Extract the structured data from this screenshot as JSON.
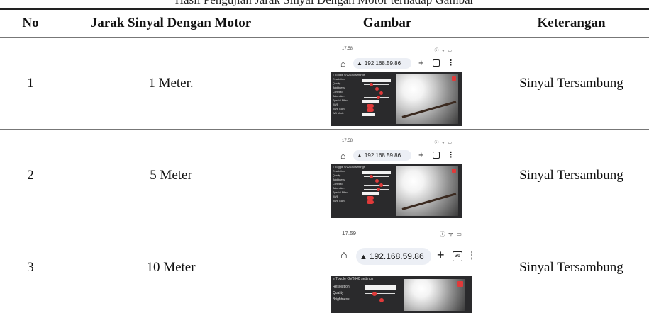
{
  "caption": "Hasil Pengujian Jarak Sinyal Dengan Motor terhadap Gambar",
  "table": {
    "headers": {
      "no": "No",
      "jarak": "Jarak Sinyal Dengan Motor",
      "gambar": "Gambar",
      "keterangan": "Keterangan"
    },
    "rows": [
      {
        "no": "1",
        "jarak": "1 Meter.",
        "keterangan": "Sinyal Tersambung",
        "shot": {
          "time": "17.58",
          "status_icons": "ⓘ ᯤ ▭",
          "url": "192.168.59.86",
          "tabs": "",
          "panel_title": "≡ Toggle OV2640 settings"
        }
      },
      {
        "no": "2",
        "jarak": "5 Meter",
        "keterangan": "Sinyal Tersambung",
        "shot": {
          "time": "17.58",
          "status_icons": "ⓘ ᯤ ▭",
          "url": "192.168.59.86",
          "tabs": "",
          "panel_title": "≡ Toggle OV2640 settings"
        }
      },
      {
        "no": "3",
        "jarak": "10 Meter",
        "keterangan": "Sinyal Tersambung",
        "shot": {
          "time": "17.59",
          "status_icons": "ⓘ ᯤ ▭",
          "url": "192.168.59.86",
          "tabs": "36",
          "panel_title": "≡ Toggle OV2640 settings"
        }
      }
    ]
  },
  "settings_labels": [
    "Resolution",
    "Quality",
    "Brightness",
    "Contrast",
    "Saturation",
    "Special Effect",
    "AWB",
    "AWB Gain",
    "WB Mode"
  ],
  "colors": {
    "accent": "#e03a3a",
    "panel": "#2a2a2c",
    "rule": "#222222"
  }
}
